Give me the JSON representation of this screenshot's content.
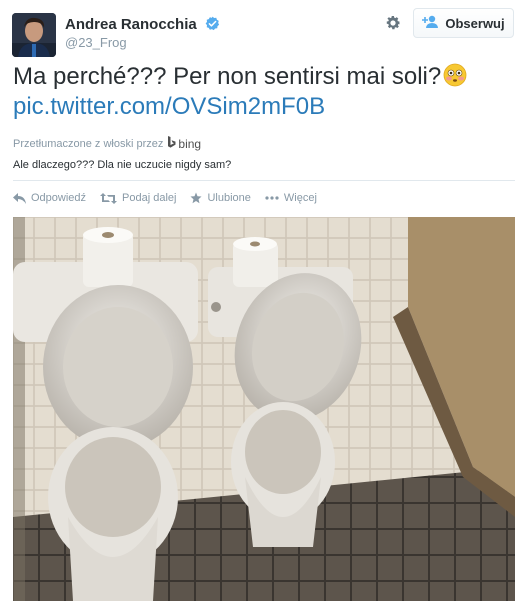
{
  "user": {
    "name": "Andrea Ranocchia",
    "handle": "@23_Frog"
  },
  "follow_label": "Obserwuj",
  "tweet": {
    "text": "Ma perché??? Per non sentirsi mai soli?",
    "link": "pic.twitter.com/OVSim2mF0B"
  },
  "translation": {
    "label": "Przetłumaczone z włoski przez",
    "provider": "bing",
    "text": "Ale dlaczego??? Dla nie uczucie nigdy sam?"
  },
  "actions": {
    "reply": "Odpowiedź",
    "retweet": "Podaj dalej",
    "favorite": "Ulubione",
    "more": "Więcej"
  },
  "colors": {
    "link": "#2b7bb9",
    "verified": "#55acee",
    "muted": "#8899a6"
  },
  "icons": [
    "verified-badge-icon",
    "gear-icon",
    "add-user-icon",
    "flushed-face-emoji-icon",
    "bing-logo-icon",
    "reply-icon",
    "retweet-icon",
    "star-icon",
    "more-dots-icon"
  ]
}
